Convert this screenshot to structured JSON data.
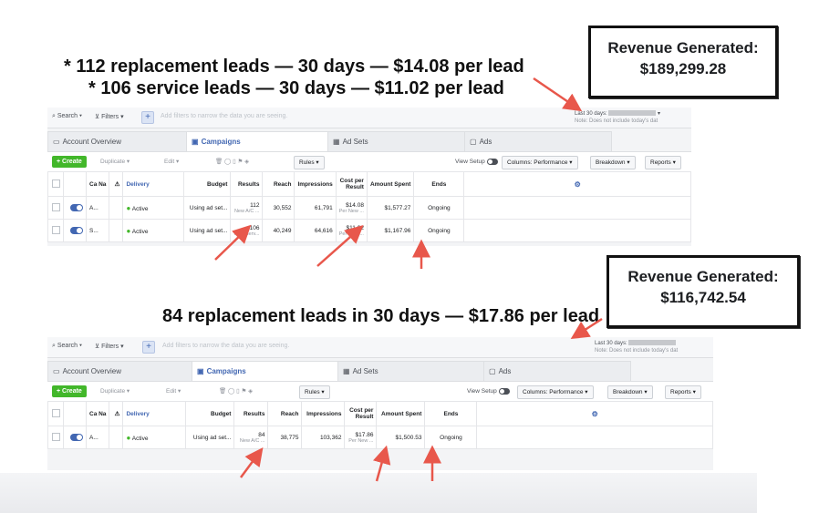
{
  "annotations": {
    "line1": "* 112 replacement leads — 30 days — $14.08 per lead",
    "line2": "* 106 service leads — 30 days — $11.02 per lead",
    "line3": "84 replacement leads in 30 days — $17.86 per lead"
  },
  "revenue_boxes": [
    {
      "label": "Revenue Generated:",
      "value": "$189,299.28"
    },
    {
      "label": "Revenue Generated:",
      "value": "$116,742.54"
    }
  ],
  "colors": {
    "accent": "#4267b2",
    "create_green": "#42b72a",
    "arrow": "#e8574b"
  },
  "screenshots": [
    {
      "topbar": {
        "search": "Search ▾",
        "filters": "Filters ▾",
        "filter_placeholder": "Add filters to narrow the data you are seeing.",
        "date_label": "Last 30 days:",
        "date_note": "Note: Does not include today's dat"
      },
      "tabs": [
        "Account Overview",
        "Campaigns",
        "Ad Sets",
        "Ads"
      ],
      "toolbar": {
        "create": "+ Create",
        "duplicate": "Duplicate ▾",
        "edit": "Edit ▾",
        "rules": "Rules ▾",
        "view_setup": "View Setup",
        "columns": "Columns: Performance ▾",
        "breakdown": "Breakdown ▾",
        "reports": "Reports ▾"
      },
      "headers": {
        "name": "Ca Na",
        "delivery": "Delivery",
        "budget": "Budget",
        "results": "Results",
        "reach": "Reach",
        "impressions": "Impressions",
        "cost": "Cost per Result",
        "spent": "Amount Spent",
        "ends": "Ends"
      },
      "rows": [
        {
          "name": "A...",
          "delivery": "Active",
          "budget": "Using ad set...",
          "results": "112",
          "results_sub": "New A/C ...",
          "reach": "30,552",
          "impressions": "61,791",
          "cost": "$14.08",
          "cost_sub": "Per New ...",
          "spent": "$1,577.27",
          "ends": "Ongoing"
        },
        {
          "name": "S...",
          "delivery": "Active",
          "budget": "Using ad set...",
          "results": "106",
          "results_sub": "New Serv...",
          "reach": "40,249",
          "impressions": "64,616",
          "cost": "$11.02",
          "cost_sub": "Per New ...",
          "spent": "$1,167.96",
          "ends": "Ongoing"
        }
      ]
    },
    {
      "topbar": {
        "search": "Search ▾",
        "filters": "Filters ▾",
        "filter_placeholder": "Add filters to narrow the data you are seeing.",
        "date_label": "Last 30 days:",
        "date_note": "Note: Does not include today's dat"
      },
      "tabs": [
        "Account Overview",
        "Campaigns",
        "Ad Sets",
        "Ads"
      ],
      "toolbar": {
        "create": "+ Create",
        "duplicate": "Duplicate ▾",
        "edit": "Edit ▾",
        "rules": "Rules ▾",
        "view_setup": "View Setup",
        "columns": "Columns: Performance ▾",
        "breakdown": "Breakdown ▾",
        "reports": "Reports ▾"
      },
      "headers": {
        "name": "Ca Na",
        "delivery": "Delivery",
        "budget": "Budget",
        "results": "Results",
        "reach": "Reach",
        "impressions": "Impressions",
        "cost": "Cost per Result",
        "spent": "Amount Spent",
        "ends": "Ends"
      },
      "rows": [
        {
          "name": "A...",
          "delivery": "Active",
          "budget": "Using ad set...",
          "results": "84",
          "results_sub": "New A/C ...",
          "reach": "38,775",
          "impressions": "103,362",
          "cost": "$17.86",
          "cost_sub": "Per New ...",
          "spent": "$1,500.53",
          "ends": "Ongoing"
        }
      ]
    }
  ]
}
